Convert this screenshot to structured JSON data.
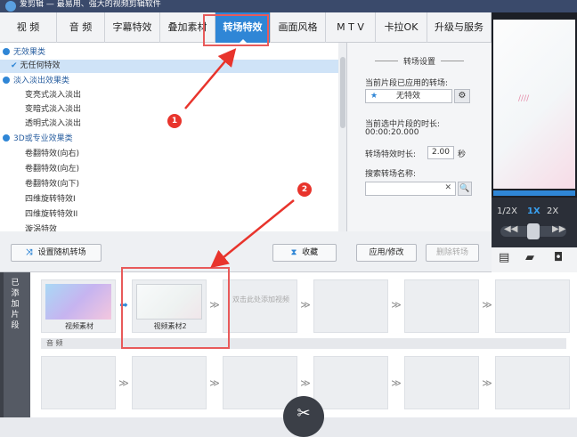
{
  "title_bar": {
    "text": "爱剪辑 — 最易用、强大的视频剪辑软件"
  },
  "tabs": [
    {
      "label": "视  频"
    },
    {
      "label": "音  频"
    },
    {
      "label": "字幕特效"
    },
    {
      "label": "叠加素材"
    },
    {
      "label": "转场特效"
    },
    {
      "label": "画面风格"
    },
    {
      "label": "M T V"
    },
    {
      "label": "卡拉OK"
    },
    {
      "label": "升级与服务"
    }
  ],
  "active_tab": "转场特效",
  "effects_tree": [
    {
      "kind": "cat",
      "label": "无效果类"
    },
    {
      "kind": "sel",
      "label": "无任何特效"
    },
    {
      "kind": "cat",
      "label": "淡入淡出效果类"
    },
    {
      "kind": "item",
      "label": "变亮式淡入淡出"
    },
    {
      "kind": "item",
      "label": "变暗式淡入淡出"
    },
    {
      "kind": "item",
      "label": "透明式淡入淡出"
    },
    {
      "kind": "cat",
      "label": "3D或专业效果类"
    },
    {
      "kind": "item",
      "label": "卷翻特效(向右)"
    },
    {
      "kind": "item",
      "label": "卷翻特效(向左)"
    },
    {
      "kind": "item",
      "label": "卷翻特效(向下)"
    },
    {
      "kind": "item",
      "label": "四维旋转特效I"
    },
    {
      "kind": "item",
      "label": "四维旋转特效II"
    },
    {
      "kind": "item",
      "label": "漩涡特效"
    }
  ],
  "settings": {
    "title": "转场设置",
    "applied_label": "当前片段已应用的转场:",
    "applied_value": "无特效",
    "clip_duration_label": "当前选中片段的时长:",
    "clip_duration_value": "00:00:20.000",
    "effect_duration_label": "转场特效时长:",
    "effect_duration_value": "2.00",
    "effect_duration_unit": "秒",
    "search_label": "搜索转场名称:",
    "search_value": ""
  },
  "buttons": {
    "random": "设置随机转场",
    "collect": "收藏",
    "apply": "应用/修改",
    "delete": "删除转场"
  },
  "speed": {
    "opt1": "1/2X",
    "opt2": "1X",
    "opt3": "2X",
    "active": "1X"
  },
  "sidebar_label": "已添加片段",
  "clips": [
    {
      "caption": "视频素材"
    },
    {
      "caption": "视频素材2"
    }
  ],
  "empty_slot_text": "双击此处添加视频",
  "audio_label": "音  频",
  "annotations": {
    "badge1": "1",
    "badge2": "2"
  },
  "colors": {
    "accent": "#2f86d6",
    "highlight": "#e85a5a",
    "title_bar": "#3a4a6b"
  }
}
